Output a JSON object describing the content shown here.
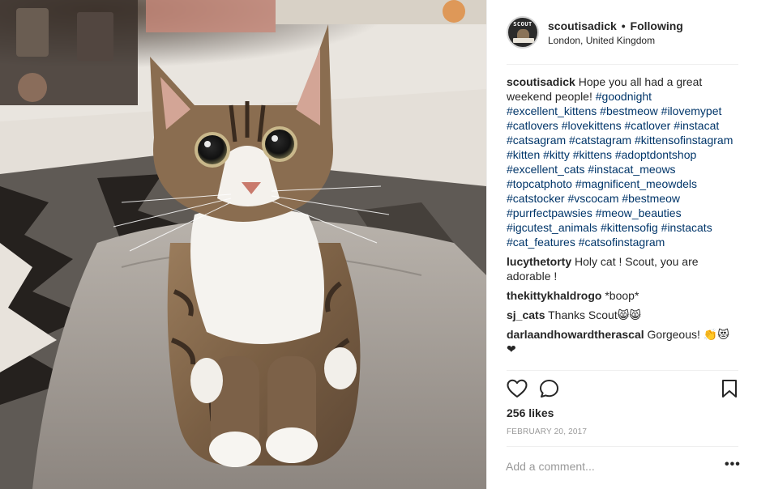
{
  "post": {
    "username": "scoutisadick",
    "separator": "•",
    "follow_status": "Following",
    "location": "London, United Kingdom",
    "avatar_text": "SCOUT",
    "caption": {
      "author": "scoutisadick",
      "text": "Hope you all had a great weekend people!",
      "hashtags": "#goodnight #excellent_kittens #bestmeow #ilovemypet #catlovers #lovekittens #catlover #instacat #catsagram #catstagram #kittensofinstagram #kitten #kitty #kittens #adoptdontshop #excellent_cats #instacat_meows #topcatphoto #magnificent_meowdels #catstocker #vscocam #bestmeow #purrfectpawsies #meow_beauties #igcutest_animals #kittensofig #instacats #cat_features #catsofinstagram"
    },
    "comments": [
      {
        "author": "lucythetorty",
        "text": "Holy cat ! Scout, you are adorable !"
      },
      {
        "author": "thekittykhaldrogo",
        "text": "*boop*"
      },
      {
        "author": "sj_cats",
        "text": "Thanks Scout😸😸"
      },
      {
        "author": "darlaandhowardtherascal",
        "text": "Gorgeous! 👏😻❤"
      }
    ],
    "likes": "256 likes",
    "date": "FEBRUARY 20, 2017",
    "add_comment_placeholder": "Add a comment...",
    "more_label": "•••",
    "icons": {
      "like": "heart-icon",
      "comment": "comment-bubble-icon",
      "save": "bookmark-icon",
      "more": "more-options-icon"
    }
  }
}
